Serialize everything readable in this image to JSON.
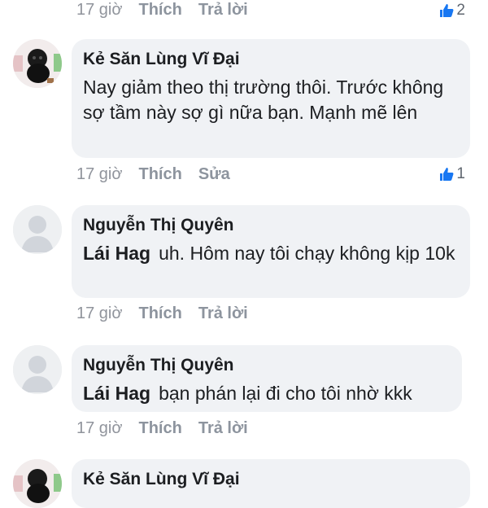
{
  "top_row": {
    "time": "17 giờ",
    "like": "Thích",
    "reply": "Trả lời",
    "reactions": "2"
  },
  "comments": [
    {
      "author": "Kẻ Săn Lùng Vĩ Đại",
      "avatar": "black-dog-avatar",
      "text": "Nay giảm theo thị trường thôi. Trước không sợ tầm này sợ gì nữa bạn. Mạnh mẽ lên",
      "time": "17 giờ",
      "like": "Thích",
      "action2": "Sửa",
      "reactions": "1"
    },
    {
      "author": "Nguyễn Thị Quyên",
      "avatar": "default-user-avatar",
      "mention": "Lái Hag",
      "text": "uh. Hôm nay tôi chạy không kịp 10k",
      "time": "17 giờ",
      "like": "Thích",
      "action2": "Trả lời"
    },
    {
      "author": "Nguyễn Thị Quyên",
      "avatar": "default-user-avatar",
      "mention": "Lái Hag",
      "text": "bạn phán lại đi cho tôi nhờ kkk",
      "time": "17 giờ",
      "like": "Thích",
      "action2": "Trả lời"
    },
    {
      "author": "Kẻ Săn Lùng Vĩ Đại",
      "avatar": "black-dog-avatar"
    }
  ],
  "colors": {
    "bubble": "#f0f2f5",
    "like_blue": "#1877f2",
    "meta_gray": "#90949c"
  }
}
